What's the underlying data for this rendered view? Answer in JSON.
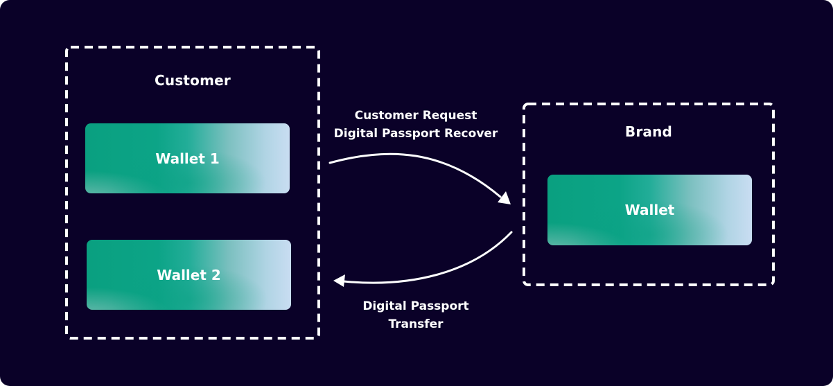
{
  "diagram": {
    "customer_group": {
      "title": "Customer",
      "wallets": [
        {
          "label": "Wallet 1"
        },
        {
          "label": "Wallet 2"
        }
      ]
    },
    "brand_group": {
      "title": "Brand",
      "wallets": [
        {
          "label": "Wallet"
        }
      ]
    },
    "flows": [
      {
        "from": "Customer",
        "to": "Brand",
        "label_line1": "Customer Request",
        "label_line2": "Digital Passport Recover"
      },
      {
        "from": "Brand",
        "to": "Customer",
        "label_line1": "Digital Passport",
        "label_line2": "Transfer"
      }
    ],
    "colors": {
      "background": "#0a0128",
      "wallet_green": "#0aa080",
      "wallet_light": "#c9ddf2",
      "stroke": "#ffffff"
    }
  }
}
